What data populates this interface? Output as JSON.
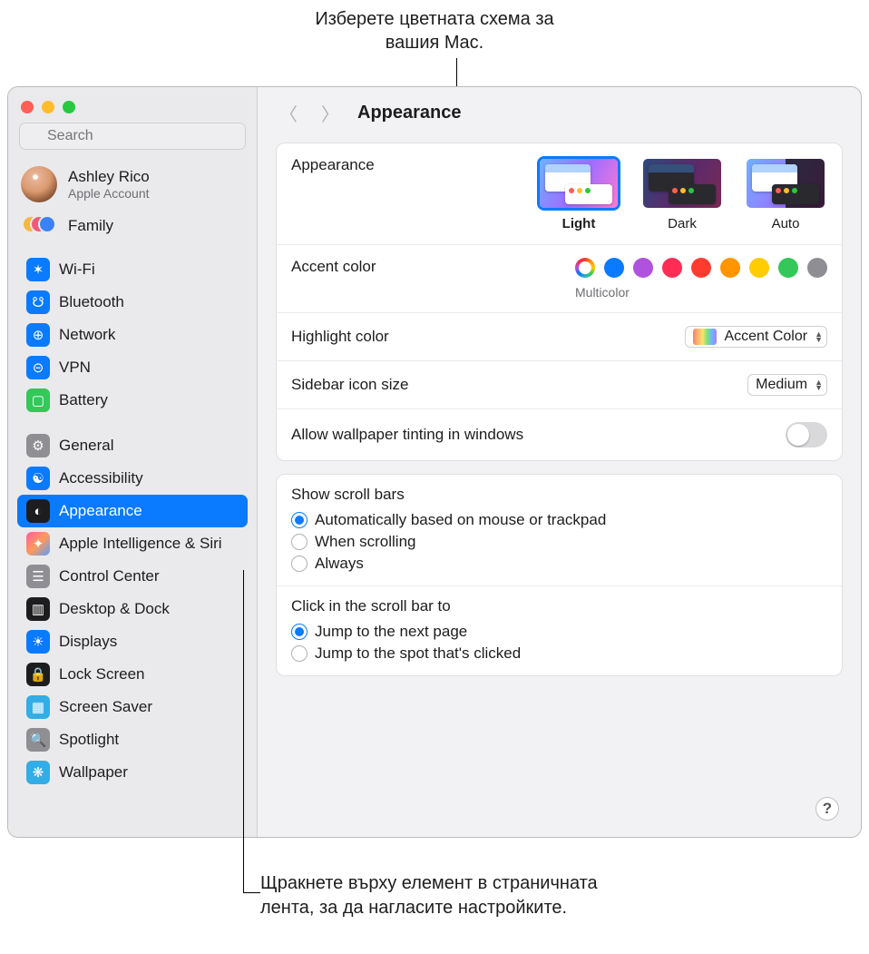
{
  "callouts": {
    "top": "Изберете цветната схема за вашия Mac.",
    "bottom": "Щракнете върху елемент в страничната лента, за да нагласите настройките."
  },
  "sidebar": {
    "search_placeholder": "Search",
    "account": {
      "name": "Ashley Rico",
      "sub": "Apple Account"
    },
    "family": "Family",
    "groups": [
      [
        {
          "id": "wifi",
          "label": "Wi-Fi",
          "icon": "ic-wifi",
          "glyph": "✶"
        },
        {
          "id": "bluetooth",
          "label": "Bluetooth",
          "icon": "ic-bt",
          "glyph": "☋"
        },
        {
          "id": "network",
          "label": "Network",
          "icon": "ic-net",
          "glyph": "⊕"
        },
        {
          "id": "vpn",
          "label": "VPN",
          "icon": "ic-vpn",
          "glyph": "⊝"
        },
        {
          "id": "battery",
          "label": "Battery",
          "icon": "ic-bat",
          "glyph": "▢"
        }
      ],
      [
        {
          "id": "general",
          "label": "General",
          "icon": "ic-gen",
          "glyph": "⚙"
        },
        {
          "id": "accessibility",
          "label": "Accessibility",
          "icon": "ic-acc",
          "glyph": "☯"
        },
        {
          "id": "appearance",
          "label": "Appearance",
          "icon": "ic-app",
          "glyph": "◐",
          "selected": true
        },
        {
          "id": "ai",
          "label": "Apple Intelligence & Siri",
          "icon": "ic-ai",
          "glyph": "✦"
        },
        {
          "id": "control-center",
          "label": "Control Center",
          "icon": "ic-cc",
          "glyph": "☰"
        },
        {
          "id": "dock",
          "label": "Desktop & Dock",
          "icon": "ic-dock",
          "glyph": "▥"
        },
        {
          "id": "displays",
          "label": "Displays",
          "icon": "ic-disp",
          "glyph": "☀"
        },
        {
          "id": "lock",
          "label": "Lock Screen",
          "icon": "ic-lock",
          "glyph": "🔒"
        },
        {
          "id": "screensaver",
          "label": "Screen Saver",
          "icon": "ic-ss",
          "glyph": "▦"
        },
        {
          "id": "spotlight",
          "label": "Spotlight",
          "icon": "ic-spot",
          "glyph": "🔍"
        },
        {
          "id": "wallpaper",
          "label": "Wallpaper",
          "icon": "ic-wall",
          "glyph": "❋"
        }
      ]
    ]
  },
  "header": {
    "title": "Appearance"
  },
  "appearance": {
    "label": "Appearance",
    "options": [
      {
        "id": "light",
        "label": "Light",
        "selected": true
      },
      {
        "id": "dark",
        "label": "Dark",
        "selected": false
      },
      {
        "id": "auto",
        "label": "Auto",
        "selected": false
      }
    ]
  },
  "accent": {
    "label": "Accent color",
    "selected_name": "Multicolor",
    "colors": [
      "multi",
      "blue",
      "purple",
      "pink",
      "red",
      "orange",
      "yellow",
      "green",
      "gray"
    ]
  },
  "highlight": {
    "label": "Highlight color",
    "value": "Accent Color"
  },
  "sidebar_size": {
    "label": "Sidebar icon size",
    "value": "Medium"
  },
  "tinting": {
    "label": "Allow wallpaper tinting in windows",
    "on": false
  },
  "scrollbars": {
    "title": "Show scroll bars",
    "options": [
      {
        "label": "Automatically based on mouse or trackpad",
        "checked": true
      },
      {
        "label": "When scrolling",
        "checked": false
      },
      {
        "label": "Always",
        "checked": false
      }
    ]
  },
  "scrollclick": {
    "title": "Click in the scroll bar to",
    "options": [
      {
        "label": "Jump to the next page",
        "checked": true
      },
      {
        "label": "Jump to the spot that's clicked",
        "checked": false
      }
    ]
  },
  "help_glyph": "?"
}
